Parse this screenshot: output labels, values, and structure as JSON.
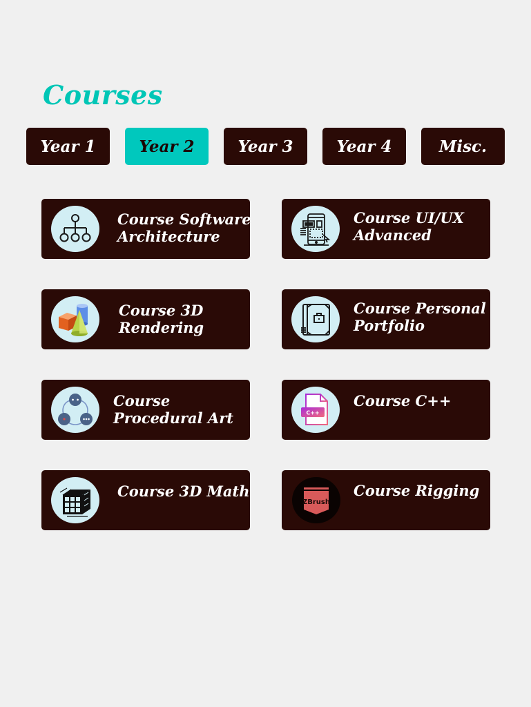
{
  "page": {
    "title": "Courses"
  },
  "tabs": [
    {
      "label": "Year 1",
      "active": false
    },
    {
      "label": "Year 2",
      "active": true
    },
    {
      "label": "Year 3",
      "active": false
    },
    {
      "label": "Year 4",
      "active": false
    },
    {
      "label": "Misc.",
      "active": false
    }
  ],
  "courses": [
    {
      "label": "Course Software Architecture",
      "icon": "hierarchy-icon"
    },
    {
      "label": "Course UI/UX Advanced",
      "icon": "ui-devices-icon"
    },
    {
      "label": "Course 3D Rendering",
      "icon": "3d-shapes-icon"
    },
    {
      "label": "Course Personal Portfolio",
      "icon": "portfolio-icon"
    },
    {
      "label": "Course Procedural Art",
      "icon": "network-nodes-icon"
    },
    {
      "label": "Course C++",
      "icon": "cpp-file-icon"
    },
    {
      "label": "Course 3D Math",
      "icon": "3d-grid-cube-icon"
    },
    {
      "label": "Course Rigging",
      "icon": "zbrush-logo-icon"
    }
  ],
  "colors": {
    "accent": "#00c6b6",
    "card_bg": "#2a0a06",
    "page_bg": "#f0f0f0",
    "icon_bg": "#d2eef4"
  }
}
